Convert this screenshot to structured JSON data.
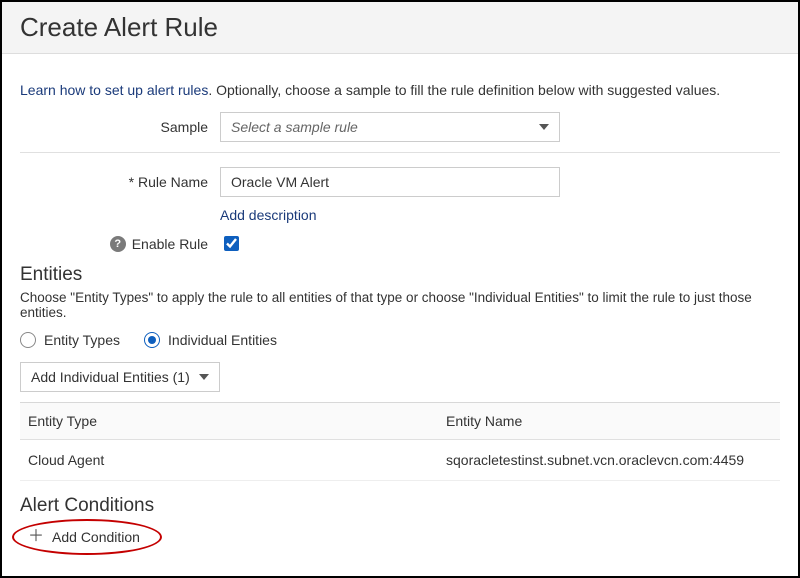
{
  "titlebar": {
    "title": "Create Alert Rule"
  },
  "intro": {
    "link_text": "Learn how to set up alert rules",
    "rest": ". Optionally, choose a sample to fill the rule definition below with suggested values."
  },
  "sample": {
    "label": "Sample",
    "placeholder": "Select a sample rule"
  },
  "rule_name": {
    "label": "Rule Name",
    "value": "Oracle VM Alert"
  },
  "add_description_label": "Add description",
  "enable_rule": {
    "label": "Enable Rule",
    "checked": true
  },
  "entities": {
    "title": "Entities",
    "desc": "Choose \"Entity Types\" to apply the rule to all entities of that type or choose \"Individual Entities\" to limit the rule to just those entities.",
    "radio_types": "Entity Types",
    "radio_individual": "Individual Entities",
    "selected": "individual",
    "dropdown_label": "Add Individual Entities (1)",
    "table": {
      "col_type": "Entity Type",
      "col_name": "Entity Name",
      "rows": [
        {
          "type": "Cloud Agent",
          "name": "sqoracletestinst.subnet.vcn.oraclevcn.com:4459"
        }
      ]
    }
  },
  "alert_conditions": {
    "title": "Alert Conditions",
    "add_label": "Add Condition"
  }
}
